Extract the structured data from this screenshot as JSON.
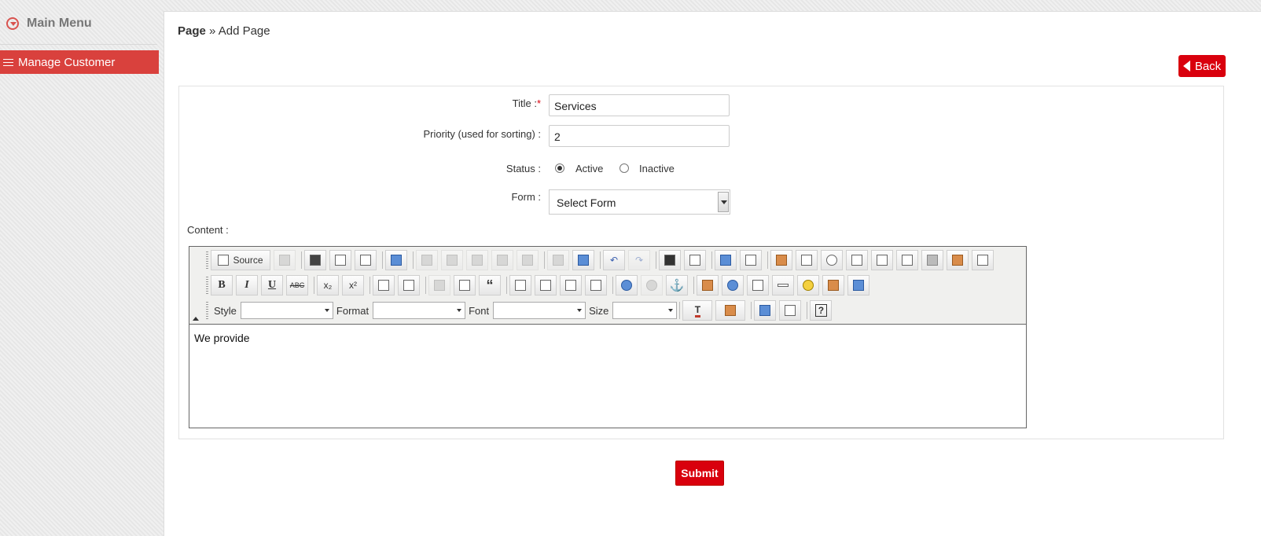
{
  "sidebar": {
    "main_menu": "Main Menu",
    "items": [
      {
        "label": "Manage Customer"
      }
    ]
  },
  "breadcrumb": {
    "root": "Page",
    "separator": " » ",
    "current": "Add Page"
  },
  "back_label": "Back",
  "form": {
    "title": {
      "label": "Title :",
      "required_mark": "*",
      "value": "Services"
    },
    "priority": {
      "label": "Priority (used for sorting) :",
      "value": "2"
    },
    "status": {
      "label": "Status :",
      "options": [
        "Active",
        "Inactive"
      ],
      "selected": "Active"
    },
    "form_select": {
      "label": "Form :",
      "selected": "Select Form"
    },
    "content": {
      "label": "Content :",
      "body": "We provide"
    }
  },
  "editor": {
    "source_label": "Source",
    "combos": {
      "style": "Style",
      "format": "Format",
      "font": "Font",
      "size": "Size"
    },
    "icons_row1": [
      "copy-icon",
      "save-icon",
      "new-page-icon",
      "preview-icon",
      "templates-icon",
      "cut-icon",
      "copy2-icon",
      "paste-icon",
      "paste-text-icon",
      "paste-word-icon",
      "print-icon",
      "spellcheck-icon",
      "undo-icon",
      "redo-icon",
      "find-icon",
      "replace-icon",
      "select-all-icon",
      "remove-format-icon",
      "form-icon",
      "checkbox-icon",
      "radio-icon",
      "textfield-icon",
      "textarea-icon",
      "select-field-icon",
      "button-icon",
      "image-button-icon",
      "hidden-field-icon"
    ],
    "icons_row2": [
      "bold-icon",
      "italic-icon",
      "underline-icon",
      "strike-icon",
      "subscript-icon",
      "superscript-icon",
      "ordered-list-icon",
      "unordered-list-icon",
      "outdent-icon",
      "indent-icon",
      "blockquote-icon",
      "align-left-icon",
      "align-center-icon",
      "align-right-icon",
      "justify-icon",
      "link-icon",
      "unlink-icon",
      "anchor-icon",
      "image-icon",
      "flash-icon",
      "table-icon",
      "horizontal-rule-icon",
      "smiley-icon",
      "special-char-icon",
      "page-break-icon"
    ],
    "icons_row3": [
      "text-color-icon",
      "bg-color-icon",
      "maximize-icon",
      "show-blocks-icon",
      "about-icon"
    ]
  },
  "submit_label": "Submit",
  "colors": {
    "accent": "#d9000d",
    "sidebar_active": "#d9413d"
  }
}
